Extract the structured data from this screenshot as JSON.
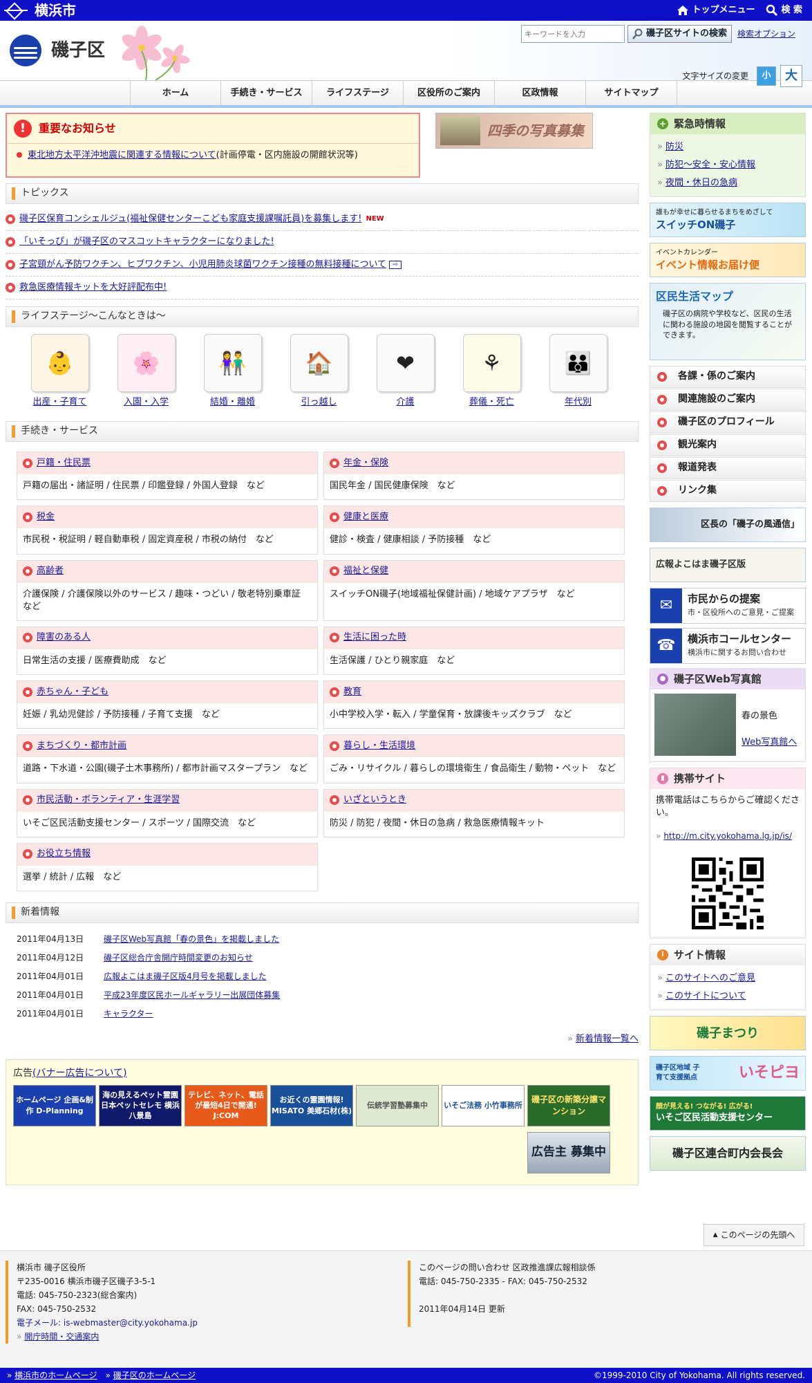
{
  "topbar": {
    "city": "横浜市",
    "top_menu": "トップメニュー",
    "search": "検 索"
  },
  "header": {
    "ward": "磯子区",
    "search_placeholder": "キーワードを入力",
    "search_button": "磯子区サイトの検索",
    "search_option": "検索オプション",
    "fontsize_label": "文字サイズの変更",
    "fontsize_small": "小",
    "fontsize_large": "大"
  },
  "nav": [
    "ホーム",
    "手続き・サービス",
    "ライフステージ",
    "区役所のご案内",
    "区政情報",
    "サイトマップ"
  ],
  "notice": {
    "title": "重要なお知らせ",
    "link": "東北地方太平洋沖地震に関連する情報について",
    "rest": "(計画停電・区内施設の開館状況等)"
  },
  "photo_banner": "四季の写真募集",
  "topics": {
    "title": "トピックス",
    "items": [
      {
        "text": "磯子区保育コンシェルジュ(福祉保健センターこども家庭支援課嘱託員)を募集します!",
        "badge": "NEW"
      },
      {
        "text": "「いそっぴ」が磯子区のマスコットキャラクターになりました!",
        "badge": ""
      },
      {
        "text": "子宮頸がん予防ワクチン、ヒブワクチン、小児用肺炎球菌ワクチン接種の無料接種について",
        "badge": ""
      },
      {
        "text": "救急医療情報キットを大好評配布中!",
        "badge": ""
      }
    ]
  },
  "lifestage": {
    "title": "ライフステージ～こんなときは～",
    "items": [
      "出産・子育て",
      "入園・入学",
      "結婚・離婚",
      "引っ越し",
      "介護",
      "葬儀・死亡",
      "年代別"
    ]
  },
  "services": {
    "title": "手続き・サービス",
    "items": [
      {
        "title": "戸籍・住民票",
        "desc": "戸籍の届出・諸証明 / 住民票 / 印鑑登録 / 外国人登録　など"
      },
      {
        "title": "年金・保険",
        "desc": "国民年金 / 国民健康保険　など"
      },
      {
        "title": "税金",
        "desc": "市民税・税証明 / 軽自動車税 / 固定資産税 / 市税の納付　など"
      },
      {
        "title": "健康と医療",
        "desc": "健診・検査 / 健康相談 / 予防接種　など"
      },
      {
        "title": "高齢者",
        "desc": "介護保険 / 介護保険以外のサービス / 趣味・つどい / 敬老特別乗車証　など"
      },
      {
        "title": "福祉と保健",
        "desc": "スイッチON磯子(地域福祉保健計画) / 地域ケアプラザ　など"
      },
      {
        "title": "障害のある人",
        "desc": "日常生活の支援 / 医療費助成　など"
      },
      {
        "title": "生活に困った時",
        "desc": "生活保護 / ひとり親家庭　など"
      },
      {
        "title": "赤ちゃん・子ども",
        "desc": "妊娠 / 乳幼児健診 / 予防接種 / 子育て支援　など"
      },
      {
        "title": "教育",
        "desc": "小中学校入学・転入 / 学童保育・放課後キッズクラブ　など"
      },
      {
        "title": "まちづくり・都市計画",
        "desc": "道路・下水道・公園(磯子土木事務所) / 都市計画マスタープラン　など"
      },
      {
        "title": "暮らし・生活環境",
        "desc": "ごみ・リサイクル / 暮らしの環境衛生 / 食品衛生 / 動物・ペット　など"
      },
      {
        "title": "市民活動・ボランティア・生涯学習",
        "desc": "いそご区民活動支援センター / スポーツ / 国際交流　など"
      },
      {
        "title": "いざというとき",
        "desc": "防災 / 防犯 / 夜間・休日の急病 / 救急医療情報キット"
      },
      {
        "title": "お役立ち情報",
        "desc": "選挙 / 統計 / 広報　など"
      }
    ]
  },
  "news": {
    "title": "新着情報",
    "items": [
      {
        "date": "2011年04月13日",
        "text": "磯子区Web写真館「春の景色」を掲載しました"
      },
      {
        "date": "2011年04月12日",
        "text": "磯子区総合庁舎開庁時間変更のお知らせ"
      },
      {
        "date": "2011年04月01日",
        "text": "広報よこはま磯子区版4月号を掲載しました"
      },
      {
        "date": "2011年04月01日",
        "text": "平成23年度区民ホールギャラリー出展団体募集"
      },
      {
        "date": "2011年04月01日",
        "text": "キャラクター"
      }
    ],
    "more": "新着情報一覧へ"
  },
  "ads": {
    "label": "広告",
    "link": "(バナー広告について)",
    "items": [
      "ホームページ 企画&制作 D-Planning",
      "海の見えるペット霊園 日本ペットセレモ 横浜八景島",
      "テレビ、ネット、電話が最短4日で開通! J:COM",
      "お近くの霊園情報! MISATO 美郷石材(株)",
      "伝統学習塾募集中",
      "いそご法務 小竹事務所",
      "磯子区の新築分譲マンション",
      "広告主 募集中"
    ]
  },
  "pagetop": "このページの先頭へ",
  "side": {
    "emergency": {
      "title": "緊急時情報",
      "links": [
        "防災",
        "防犯～安全・安心情報",
        "夜間・休日の急病"
      ]
    },
    "switch_banner": {
      "sub": "誰もが幸せに暮らせるまちをめざして",
      "main": "スイッチON磯子"
    },
    "event_banner": {
      "sub": "イベントカレンダー",
      "main": "イベント情報お届け便"
    },
    "map_banner": {
      "title": "区民生活マップ",
      "desc": "磯子区の病院や学校など、区民の生活に関わる施設の地図を閲覧することができます。"
    },
    "menu": [
      "各課・係のご案内",
      "関連施設のご案内",
      "磯子区のプロフィール",
      "観光案内",
      "報道発表",
      "リンク集"
    ],
    "mayor_banner": "区長の「磯子の風通信」",
    "koho_banner": "広報よこはま磯子区版",
    "proposal": {
      "title": "市民からの提案",
      "desc": "市・区役所へのご意見・ご提案"
    },
    "callcenter": {
      "title": "横浜市コールセンター",
      "desc": "横浜市に関するお問い合わせ"
    },
    "photo": {
      "title": "磯子区Web写真館",
      "caption": "春の景色",
      "link": "Web写真館へ"
    },
    "mobile": {
      "title": "携帯サイト",
      "desc": "携帯電話はこちらからご確認ください。",
      "url": "http://m.city.yokohama.lg.jp/is/"
    },
    "siteinfo": {
      "title": "サイト情報",
      "links": [
        "このサイトへのご意見",
        "このサイトについて"
      ]
    },
    "festival": "磯子まつり",
    "isopiyo": {
      "sub": "磯子区地域 子育て支援拠点",
      "main": "いそピヨ"
    },
    "center": {
      "sub": "顔が見える! つながる! 広がる!",
      "main": "いそご区民活動支援センター"
    },
    "chokai": "磯子区連合町内会長会"
  },
  "footer": {
    "left": [
      "横浜市 磯子区役所",
      "〒235-0016 横浜市磯子区磯子3-5-1",
      "電話: 045-750-2323(総合案内)",
      "FAX: 045-750-2532",
      "電子メール: is-webmaster@city.yokohama.jp",
      "開庁時間・交通案内"
    ],
    "right": [
      "このページの問い合わせ 区政推進課広報相談係",
      "電話: 045-750-2335 - FAX: 045-750-2532",
      "",
      "2011年04月14日 更新"
    ]
  },
  "bottom": {
    "link1": "横浜市のホームページ",
    "link2": "磯子区のホームページ",
    "copyright": "©1999-2010 City of Yokohama. All rights reserved."
  }
}
